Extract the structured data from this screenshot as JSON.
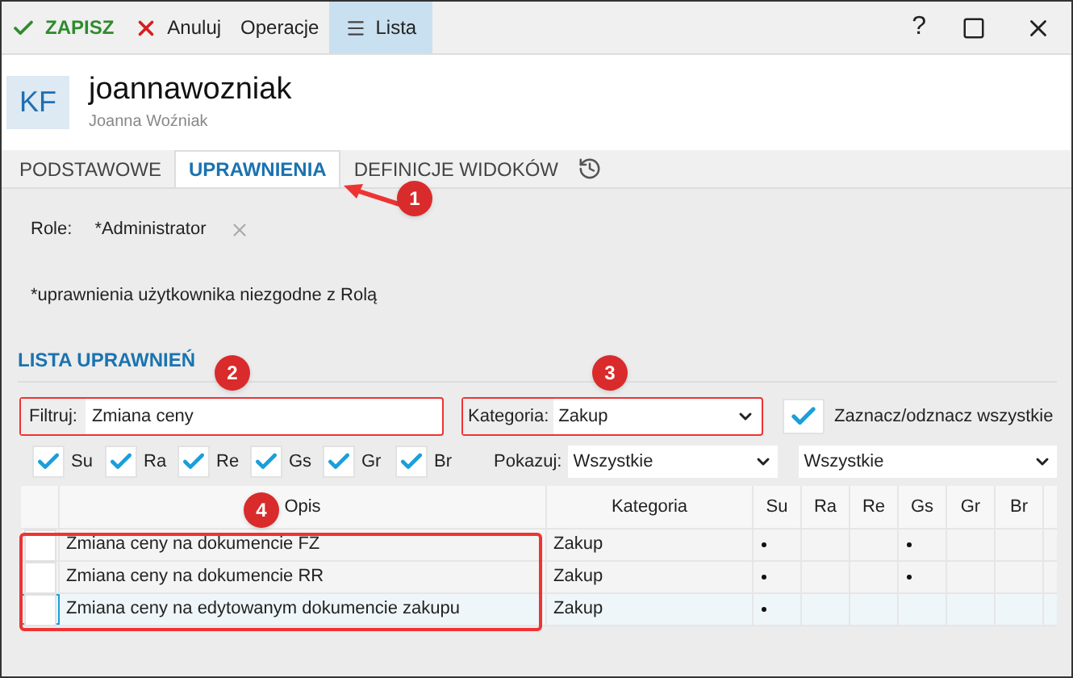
{
  "toolbar": [
    {
      "label": "ZAPISZ",
      "kind": "save",
      "selected": false
    },
    {
      "label": "Anuluj",
      "kind": "cancel",
      "selected": false
    },
    {
      "label": "Operacje",
      "kind": "plain",
      "selected": false
    },
    {
      "label": "Lista",
      "kind": "list",
      "selected": true
    }
  ],
  "help_label": "?",
  "user": {
    "initials": "KF",
    "login": "joannawozniak",
    "full_name": "Joanna Woźniak"
  },
  "tabs": [
    {
      "label": "PODSTAWOWE",
      "selected": false
    },
    {
      "label": "UPRAWNIENIA",
      "selected": true
    },
    {
      "label": "DEFINICJE WIDOKÓW",
      "selected": false
    }
  ],
  "role": {
    "label": "Role:",
    "value": "*Administrator"
  },
  "note": "*uprawnienia użytkownika niezgodne z Rolą",
  "section_title": "LISTA UPRAWNIEŃ",
  "filter": {
    "label": "Filtruj:",
    "value": "Zmiana ceny"
  },
  "category": {
    "label": "Kategoria:",
    "value": "Zakup"
  },
  "select_all": {
    "label": "Zaznacz/odznacz wszystkie",
    "checked": true
  },
  "column_filters": [
    {
      "label": "Su",
      "checked": true
    },
    {
      "label": "Ra",
      "checked": true
    },
    {
      "label": "Re",
      "checked": true
    },
    {
      "label": "Gs",
      "checked": true
    },
    {
      "label": "Gr",
      "checked": true
    },
    {
      "label": "Br",
      "checked": true
    }
  ],
  "show": {
    "label": "Pokazuj:",
    "value": "Wszystkie"
  },
  "show_second": {
    "value": "Wszystkie"
  },
  "table": {
    "columns": [
      "Opis",
      "Kategoria",
      "Su",
      "Ra",
      "Re",
      "Gs",
      "Gr",
      "Br"
    ],
    "rows": [
      {
        "checked": false,
        "selected": false,
        "description": "Zmiana ceny na dokumencie FZ",
        "category": "Zakup",
        "marks": [
          true,
          false,
          false,
          true,
          false,
          false
        ]
      },
      {
        "checked": false,
        "selected": false,
        "description": "Zmiana ceny na dokumencie RR",
        "category": "Zakup",
        "marks": [
          true,
          false,
          false,
          true,
          false,
          false
        ]
      },
      {
        "checked": false,
        "selected": true,
        "description": "Zmiana ceny na edytowanym dokumencie zakupu",
        "category": "Zakup",
        "marks": [
          true,
          false,
          false,
          false,
          false,
          false
        ]
      }
    ]
  },
  "annotations": [
    {
      "number": "1"
    },
    {
      "number": "2"
    },
    {
      "number": "3"
    },
    {
      "number": "4"
    }
  ]
}
